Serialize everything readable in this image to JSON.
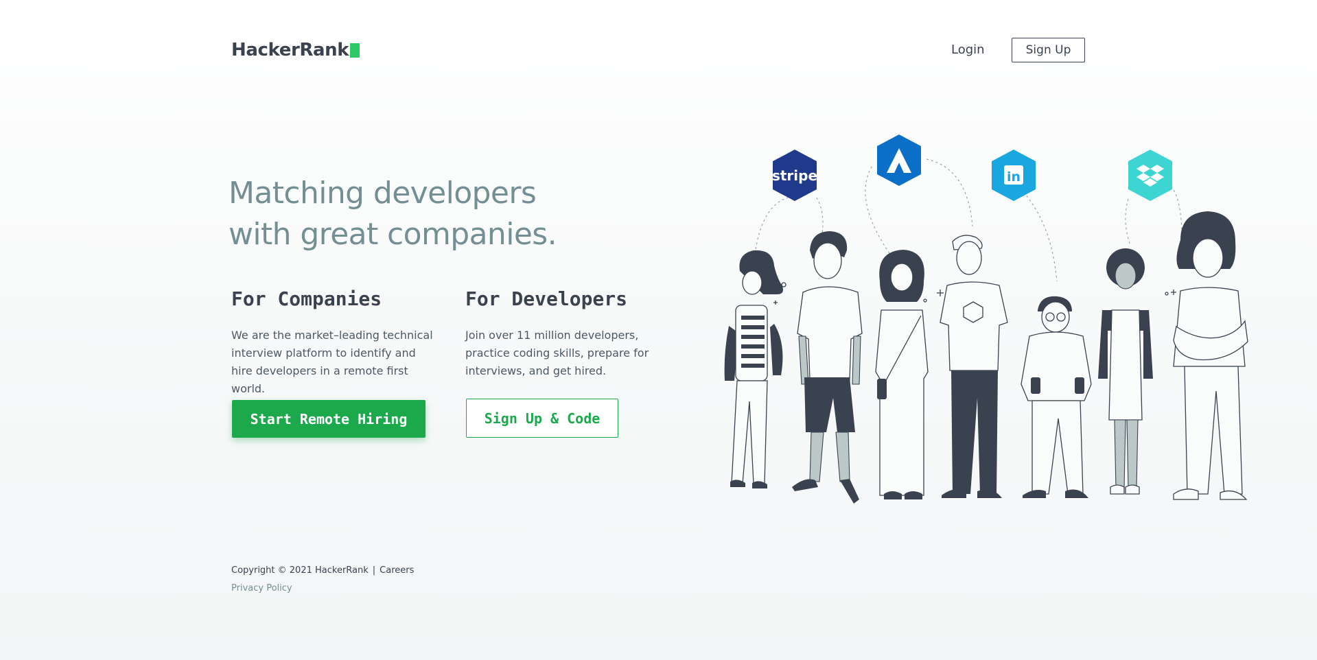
{
  "header": {
    "logo_text": "HackerRank",
    "login_label": "Login",
    "signup_label": "Sign Up"
  },
  "hero": {
    "title_line1": "Matching developers",
    "title_line2": "with great companies."
  },
  "companies": {
    "heading": "For Companies",
    "description": "We are the market–leading technical interview platform to identify and hire developers  in a remote first world.",
    "button_label": "Start Remote Hiring"
  },
  "developers": {
    "heading": "For Developers",
    "description": "Join over 11 million developers, practice coding skills, prepare for interviews, and get hired.",
    "button_label": "Sign Up & Code"
  },
  "illustration": {
    "logos": [
      {
        "name": "stripe",
        "text": "stripe",
        "color": "#1f3a8a"
      },
      {
        "name": "atlassian",
        "text": "",
        "color": "#0b6fc7"
      },
      {
        "name": "linkedin",
        "text": "in",
        "color": "#1aa6de"
      },
      {
        "name": "dropbox",
        "text": "",
        "color": "#3dd5d2"
      }
    ]
  },
  "footer": {
    "copyright": "Copyright © 2021 HackerRank",
    "separator": "|",
    "careers": "Careers",
    "privacy": "Privacy Policy"
  },
  "colors": {
    "accent": "#1ba94c",
    "brand_mark": "#2ec866",
    "text_dark": "#39424e",
    "hero_text": "#738f93"
  }
}
